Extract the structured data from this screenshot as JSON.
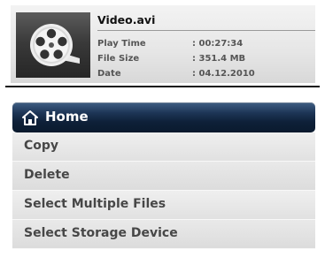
{
  "file_info": {
    "thumbnail_icon": "film-reel-icon",
    "name": "Video.avi",
    "play_time_label": "Play Time",
    "play_time_value": ": 00:27:34",
    "file_size_label": "File Size",
    "file_size_value": ": 351.4 MB",
    "date_label": "Date",
    "date_value": ": 04.12.2010"
  },
  "menu": {
    "home": {
      "icon": "home-icon",
      "label": "Home"
    },
    "items": [
      {
        "label": "Copy"
      },
      {
        "label": "Delete"
      },
      {
        "label": "Select Multiple Files"
      },
      {
        "label": "Select Storage Device"
      }
    ]
  },
  "colors": {
    "home_bar": "#0e2038",
    "menu_text": "#474747",
    "panel_bg": "#e6e6e6"
  }
}
